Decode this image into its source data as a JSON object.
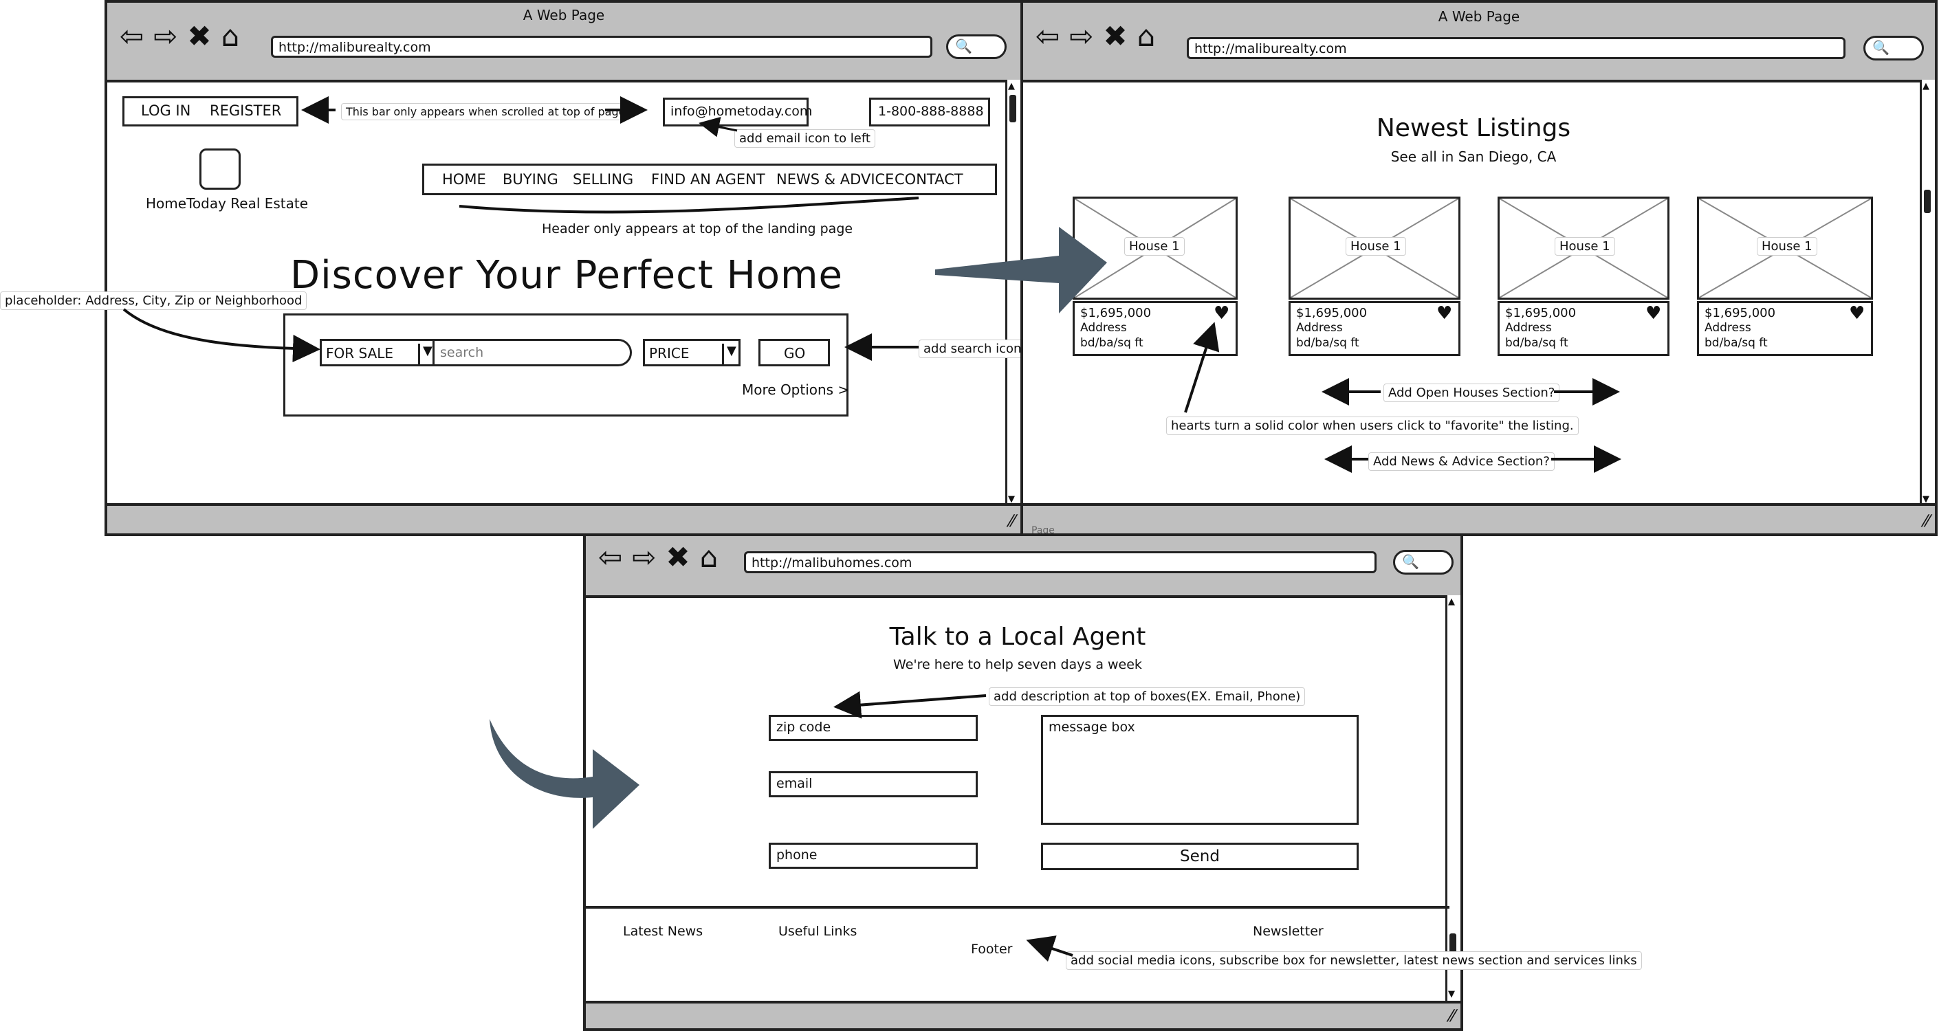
{
  "win1": {
    "title": "A Web Page",
    "url": "http://maliburealty.com",
    "login": "LOG IN",
    "register": "REGISTER",
    "note_bar": "This bar only appears when scrolled at top of page",
    "email": "info@hometoday.com",
    "note_email": "add email icon to left",
    "phone": "1-800-888-8888",
    "logo_text": "HomeToday Real Estate",
    "nav": [
      "HOME",
      "BUYING",
      "SELLING",
      "FIND AN AGENT",
      "NEWS & ADVICE",
      "CONTACT"
    ],
    "note_header": "Header only appears at top of the landing page",
    "headline": "Discover Your Perfect Home",
    "note_placeholder": "placeholder: Address, City, Zip or Neighborhood",
    "for_sale": "FOR SALE",
    "search_placeholder": "search",
    "price": "PRICE",
    "go": "GO",
    "more_options": "More Options >",
    "note_search_icon": "add search icon here"
  },
  "win2": {
    "title": "A Web Page",
    "url": "http://maliburealty.com",
    "heading": "Newest Listings",
    "subheading": "See all in San Diego, CA",
    "listings": [
      {
        "label": "House 1",
        "price": "$1,695,000",
        "address": "Address",
        "details": "bd/ba/sq ft"
      },
      {
        "label": "House 1",
        "price": "$1,695,000",
        "address": "Address",
        "details": "bd/ba/sq ft"
      },
      {
        "label": "House 1",
        "price": "$1,695,000",
        "address": "Address",
        "details": "bd/ba/sq ft"
      },
      {
        "label": "House 1",
        "price": "$1,695,000",
        "address": "Address",
        "details": "bd/ba/sq ft"
      }
    ],
    "note_open_houses": "Add Open Houses Section?",
    "note_hearts": "hearts turn a solid color when users click to \"favorite\" the listing.",
    "note_news": "Add News & Advice Section?",
    "under_label": "Page"
  },
  "win3": {
    "url": "http://malibuhomes.com",
    "heading": "Talk to a Local Agent",
    "subheading": "We're here to help seven days a week",
    "note_description": "add description at top of boxes(EX. Email, Phone)",
    "zip": "zip code",
    "email": "email",
    "phone": "phone",
    "message": "message box",
    "send": "Send",
    "footer_latest": "Latest News",
    "footer_links": "Useful Links",
    "footer_newsletter": "Newsletter",
    "footer_label": "Footer",
    "note_footer": "add social media icons, subscribe box for newsletter, latest news section and services links"
  },
  "colors": {
    "big_arrow": "#4a5a67",
    "stroke": "#222222",
    "chrome": "#bfbfbf"
  },
  "icons": [
    "back-arrow-icon",
    "forward-arrow-icon",
    "close-x-icon",
    "home-icon",
    "magnifier-icon",
    "heart-icon",
    "resize-grip-icon"
  ]
}
